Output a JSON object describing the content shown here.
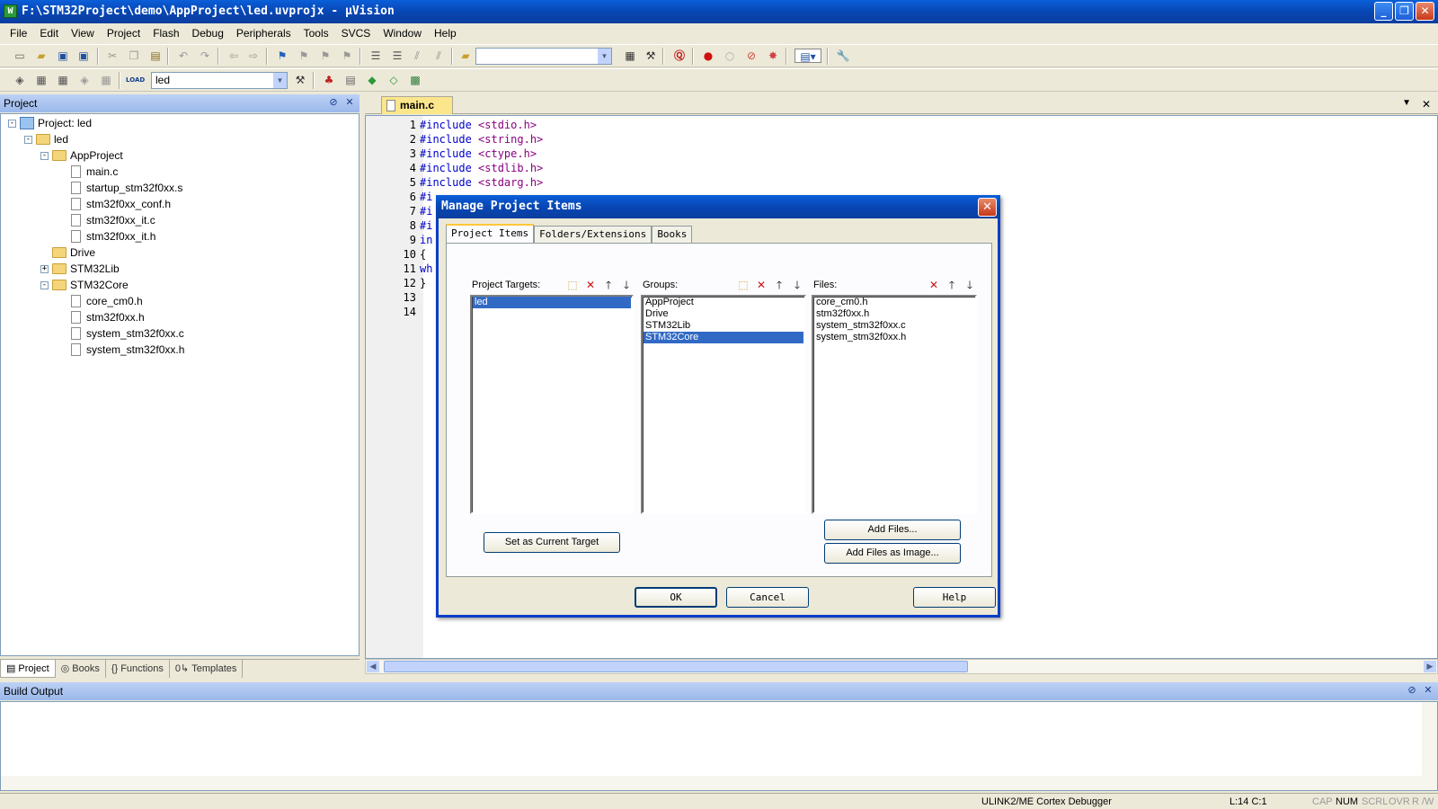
{
  "window": {
    "title": "F:\\STM32Project\\demo\\AppProject\\led.uvprojx - µVision",
    "app_icon": "W",
    "buttons": {
      "minimize": "_",
      "maximize": "❐",
      "close": "✕"
    }
  },
  "menu": [
    "File",
    "Edit",
    "View",
    "Project",
    "Flash",
    "Debug",
    "Peripherals",
    "Tools",
    "SVCS",
    "Window",
    "Help"
  ],
  "toolbar1": {
    "search_combo_value": "",
    "icons": [
      "new-file-icon",
      "open-icon",
      "save-icon",
      "save-all-icon",
      "cut-icon",
      "copy-icon",
      "paste-icon",
      "undo-icon",
      "redo-icon",
      "nav-back-icon",
      "nav-forward-icon",
      "bookmark-icon",
      "prev-bookmark-icon",
      "next-bookmark-icon",
      "clear-bookmarks-icon",
      "indent-icon",
      "unindent-icon",
      "comment-icon",
      "uncomment-icon",
      "find-in-files-icon",
      "find-icon",
      "incremental-find-icon",
      "debug-session-icon",
      "breakpoint-icon",
      "disable-breakpoint-icon",
      "disable-all-breakpoints-icon",
      "kill-all-breakpoints-icon",
      "window-layout-icon",
      "configure-icon"
    ]
  },
  "toolbar2": {
    "target_combo_value": "led",
    "load_label": "LOAD"
  },
  "project_pane": {
    "title": "Project",
    "tree": [
      {
        "label": "Project: led",
        "level": 0,
        "type": "project",
        "expander": "-"
      },
      {
        "label": "led",
        "level": 1,
        "type": "folder",
        "expander": "-"
      },
      {
        "label": "AppProject",
        "level": 2,
        "type": "folder",
        "expander": "-"
      },
      {
        "label": "main.c",
        "level": 3,
        "type": "file"
      },
      {
        "label": "startup_stm32f0xx.s",
        "level": 3,
        "type": "file"
      },
      {
        "label": "stm32f0xx_conf.h",
        "level": 3,
        "type": "file"
      },
      {
        "label": "stm32f0xx_it.c",
        "level": 3,
        "type": "file"
      },
      {
        "label": "stm32f0xx_it.h",
        "level": 3,
        "type": "file"
      },
      {
        "label": "Drive",
        "level": 2,
        "type": "folder",
        "expander": ""
      },
      {
        "label": "STM32Lib",
        "level": 2,
        "type": "folder",
        "expander": "+"
      },
      {
        "label": "STM32Core",
        "level": 2,
        "type": "folder",
        "expander": "-"
      },
      {
        "label": "core_cm0.h",
        "level": 3,
        "type": "file"
      },
      {
        "label": "stm32f0xx.h",
        "level": 3,
        "type": "file"
      },
      {
        "label": "system_stm32f0xx.c",
        "level": 3,
        "type": "file"
      },
      {
        "label": "system_stm32f0xx.h",
        "level": 3,
        "type": "file"
      }
    ],
    "tabs": [
      {
        "label": "Project",
        "icon": "▤"
      },
      {
        "label": "Books",
        "icon": "◎"
      },
      {
        "label": "Functions",
        "icon": "{}"
      },
      {
        "label": "Templates",
        "icon": "0↳"
      }
    ]
  },
  "editor": {
    "tab_label": "main.c",
    "lines": [
      {
        "num": "1",
        "kw": "#include",
        "rest": " <stdio.h>"
      },
      {
        "num": "2",
        "kw": "#include",
        "rest": " <string.h>"
      },
      {
        "num": "3",
        "kw": "#include",
        "rest": " <ctype.h>"
      },
      {
        "num": "4",
        "kw": "#include",
        "rest": " <stdlib.h>"
      },
      {
        "num": "5",
        "kw": "#include",
        "rest": " <stdarg.h>"
      },
      {
        "num": "6",
        "kw": "#i",
        "rest": ""
      },
      {
        "num": "7",
        "kw": "#i",
        "rest": ""
      },
      {
        "num": "8",
        "kw": "#i",
        "rest": ""
      },
      {
        "num": "9",
        "kw": "in",
        "rest": ""
      },
      {
        "num": "10",
        "kw": "",
        "rest": "{"
      },
      {
        "num": "11",
        "kw": "wh",
        "rest": ""
      },
      {
        "num": "12",
        "kw": "",
        "rest": "}"
      },
      {
        "num": "13",
        "kw": "",
        "rest": ""
      },
      {
        "num": "14",
        "kw": "",
        "rest": ""
      }
    ]
  },
  "build_output": {
    "title": "Build Output"
  },
  "status_bar": {
    "debugger": "ULINK2/ME Cortex Debugger",
    "position": "L:14 C:1",
    "cap": "CAP",
    "num": "NUM",
    "scrl": "SCRL",
    "ovr": "OVR",
    "rw": "R /W"
  },
  "dialog": {
    "title": "Manage Project Items",
    "tabs": [
      "Project Items",
      "Folders/Extensions",
      "Books"
    ],
    "targets": {
      "label": "Project Targets:",
      "items": [
        "led"
      ],
      "selected": "led"
    },
    "groups": {
      "label": "Groups:",
      "items": [
        "AppProject",
        "Drive",
        "STM32Lib",
        "STM32Core"
      ],
      "selected": "STM32Core"
    },
    "files": {
      "label": "Files:",
      "items": [
        "core_cm0.h",
        "stm32f0xx.h",
        "system_stm32f0xx.c",
        "system_stm32f0xx.h"
      ]
    },
    "buttons": {
      "set_target": "Set as Current Target",
      "add_files": "Add Files...",
      "add_files_image": "Add Files as Image...",
      "ok": "OK",
      "cancel": "Cancel",
      "help": "Help"
    }
  }
}
